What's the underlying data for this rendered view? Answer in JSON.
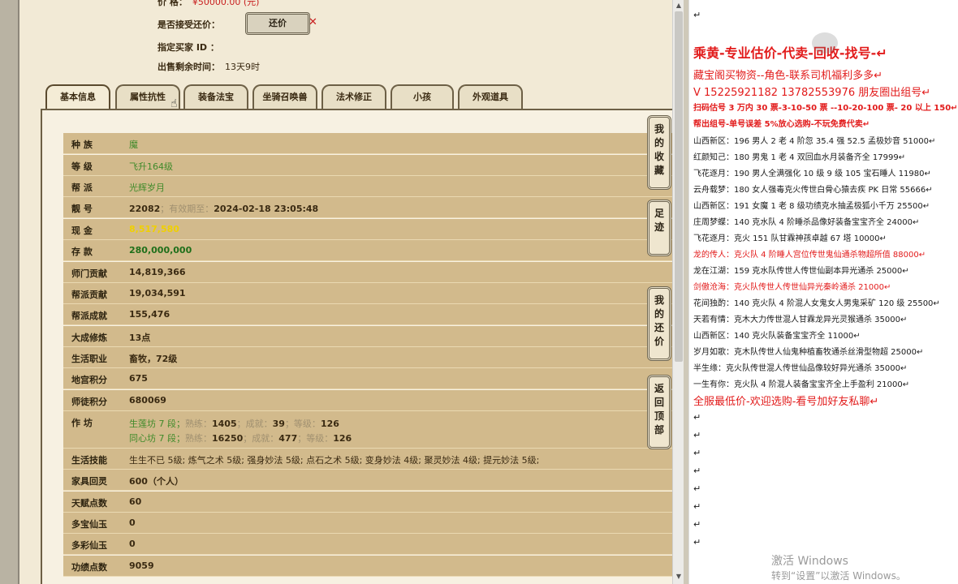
{
  "listing": {
    "price_label": "价      格：",
    "price_value": "¥50000.00 (元)",
    "counter_label": "是否接受还价：",
    "counter_button": "还价",
    "buyer_label": "指定买家 ID ：",
    "remain_label": "出售剩余时间：",
    "remain_value": "13天9时"
  },
  "tabs": [
    "基本信息",
    "属性抗性",
    "装备法宝",
    "坐骑召唤兽",
    "法术修正",
    "小孩",
    "外观道具"
  ],
  "info_rows": [
    {
      "label": "种      族",
      "value": "魔"
    },
    {
      "label": "等      级",
      "value": "飞升164级"
    },
    {
      "label": "帮      派",
      "value": "光辉岁月"
    },
    {
      "label": "靓      号",
      "value_a": "22082",
      "value_b": "；有效期至：",
      "value_c": "2024-02-18 23:05:48"
    },
    {
      "label": "现      金",
      "value": "8,517,580"
    },
    {
      "label": "存      款",
      "value": "280,000,000"
    },
    {
      "label": "师门贡献",
      "value": "14,819,366"
    },
    {
      "label": "帮派贡献",
      "value": "19,034,591"
    },
    {
      "label": "帮派成就",
      "value": "155,476"
    },
    {
      "label": "大成修炼",
      "value": "13点"
    },
    {
      "label": "生活职业",
      "value": "畜牧，72级"
    },
    {
      "label": "地宫积分",
      "value": "675"
    },
    {
      "label": "师徒积分",
      "value": "680069"
    },
    {
      "label": "作      坊",
      "line1_name": "生莲坊 7 段；",
      "line1_a": "熟练：",
      "line1_b": "1405",
      "line1_c": "；成就：",
      "line1_d": "39",
      "line1_e": "；等级：",
      "line1_f": "126",
      "line2_name": "同心坊 7 段；",
      "line2_a": "熟练：",
      "line2_b": "16250",
      "line2_c": "；成就：",
      "line2_d": "477",
      "line2_e": "；等级：",
      "line2_f": "126"
    },
    {
      "label": "生活技能",
      "value": "生生不已 5级; 炼气之术 5级; 强身妙法 5级; 点石之术 5级; 变身妙法 4级; 聚灵妙法 4级; 提元妙法 5级;"
    },
    {
      "label": "家具回灵",
      "value": "600（个人）"
    },
    {
      "label": "天赋点数",
      "value": "60"
    },
    {
      "label": "多宝仙玉",
      "value": "0"
    },
    {
      "label": "多彩仙玉",
      "value": "0"
    },
    {
      "label": "功绩点数",
      "value": "9059"
    }
  ],
  "side_buttons": [
    "我的收藏",
    "足迹",
    "我的还价",
    "返回顶部"
  ],
  "doc": {
    "lines": [
      "↵",
      "乘黄-专业估价-代卖-回收-找号-↵",
      "藏宝阁买物资--角色-联系司机福利多多↵",
      "V 15225921182    13782553976 朋友圈出组号↵",
      "扫码估号 3 万内 30 票-3-10-50 票  --10-20-100 票- 20 以上 150↵",
      "帮出组号-单号误差 5%放心选购-不玩免费代卖↵",
      "山西新区：196 男人 2 老 4 阶忽 35.4 强 52.5 孟极妙音 51000↵",
      "红颜知己：180 男鬼 1 老 4 双回血水月装备齐全 17999↵",
      "飞花逐月：190 男人全满强化 10 级 9 级 105 宝石睡人 11980↵",
      "云舟载梦：180 女人强毒克火传世白骨心猿去疾 PK 日常 55666↵",
      "山西新区：191 女魔 1 老 8 级功绩克水抽孟极狐小千万 25500↵",
      "庄周梦蝶：140 克水队 4 阶睡杀品像好装备宝宝齐全 24000↵",
      "飞花逐月：克火 151 队甘霖神孩卓越 67 塔 10000↵",
      "龙的传人：克火队 4 阶睡人宫位传世鬼仙通杀物超所值 88000↵",
      "龙在江湖：159 克水队传世人传世仙副本异光通杀 25000↵",
      "剑傲沧海：克火队传世人传世仙异光秦岭通杀 21000↵",
      "花间独酌：140 克火队 4 阶混人女鬼女人男鬼采矿 120 级 25500↵",
      "天若有情：克木大力传世混人甘霖龙异光灵猴通杀 35000↵",
      "山西新区：140 克火队装备宝宝齐全 11000↵",
      "岁月如歌：克木队传世人仙鬼种植畜牧通杀丝滑型物超 25000↵",
      "半生缘：克火队传世混人传世仙品像较好异光通杀 35000↵",
      "一生有你：克火队 4 阶混人装备宝宝齐全上手盈利 21000↵",
      "全服最低价-欢迎选购-看号加好友私聊↵",
      "↵",
      "↵",
      "↵",
      "↵",
      "↵",
      "↵",
      "↵",
      "↵"
    ]
  },
  "watermark": {
    "line1": "激活 Windows",
    "line2": "转到“设置”以激活 Windows。"
  },
  "colors": {
    "accent_red": "#e21b1b",
    "panel_tan": "#d2ba8c",
    "panel_bg": "#f7f1e2"
  }
}
